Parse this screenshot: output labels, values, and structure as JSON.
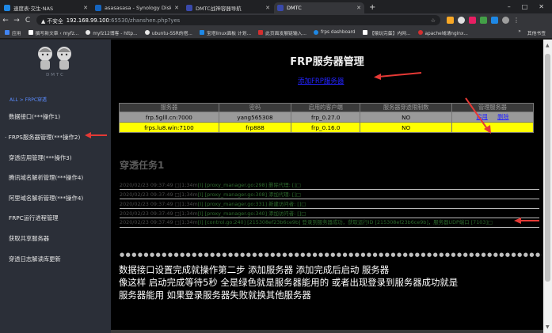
{
  "browser": {
    "tabs": [
      {
        "title": "速度表·交生·NAS",
        "color": "#1e88e5"
      },
      {
        "title": "asasasasa - Synology DiskStati",
        "color": "#1565c0"
      },
      {
        "title": "DMTC战神容器导航",
        "color": "#3949ab"
      },
      {
        "title": "DMTC",
        "color": "#3949ab"
      }
    ],
    "new_tab": "+",
    "win_min": "–",
    "win_max": "□",
    "win_close": "✕",
    "back": "←",
    "forward": "→",
    "reload": "C",
    "security_label": "▲ 不安全",
    "url_host": "192.168.99.100",
    "url_rest": ":65530/zhanshen.php?yes",
    "star": "☆",
    "bookmarks": [
      {
        "label": "应用",
        "color": "#4285f4"
      },
      {
        "label": "撰写新文章 ‹ myfz...",
        "color": "#ffffff"
      },
      {
        "label": "myfz12博客 - http...",
        "color": "#e8e8e8"
      },
      {
        "label": "ubuntu-SSR的搭...",
        "color": "#e8e8e8"
      },
      {
        "label": "宝塔linux面板 计划...",
        "color": "#1e88e5"
      },
      {
        "label": "此页面发展链输入...",
        "color": "#d32f2f"
      },
      {
        "label": "frps dashboard",
        "color": "#1e88e5"
      },
      {
        "label": "【猿玩完蛋】内网...",
        "color": "#ffffff"
      },
      {
        "label": "apache域请nginx...",
        "color": "#d32f2f"
      }
    ],
    "bookmarks_more": "»",
    "other_bookmarks": "其他书签"
  },
  "sidebar": {
    "brand": "DMTC",
    "breadcrumb": "ALL > FRPC穿透",
    "items": [
      {
        "label": "数据接口(***操作1)"
      },
      {
        "label": "· FRPS服务器管理(***操作2)"
      },
      {
        "label": "穿透应用管理(***操作3)"
      },
      {
        "label": "腾讯域名解析管理(***操作4)"
      },
      {
        "label": "阿里域名解析管理(***操作4)"
      },
      {
        "label": "FRPC运行进程管理"
      },
      {
        "label": "获取共享服务器"
      },
      {
        "label": "穿透日志解读库更新"
      }
    ]
  },
  "main": {
    "title": "FRP服务器管理",
    "add_link": "添加FRP服务器",
    "table": {
      "headers": [
        "服务器",
        "密码",
        "启用的客户端",
        "服务器穿透限制数",
        "管理服务器"
      ],
      "rows": [
        {
          "server": "frp.5glll.cn:7000",
          "password": "yang565308",
          "client": "frp_0.27.0",
          "limit": "NO",
          "enable": "启用",
          "delete": "删除"
        },
        {
          "server": "frps.lu8.win:7100",
          "password": "frp888",
          "client": "frp_0.16.0",
          "limit": "NO",
          "enable": "",
          "delete": ""
        }
      ]
    },
    "tasks_title": "穿透任务1",
    "logs": [
      {
        "prefix": "2020/02/23 09:37:49 □[1;34m",
        "msg": "[I] [proxy_manager.go:298] 删除代理: []□"
      },
      {
        "prefix": "2020/02/23 09:37:49 □[1;34m",
        "msg": "[I] [proxy_manager.go:308] 添加代理: []□"
      },
      {
        "prefix": "2020/02/23 09:37:49 □[1;34m",
        "msg": "[I] [proxy_manager.go:331] 新建访问者: []□"
      },
      {
        "prefix": "2020/02/23 09:37:49 □[1;34m",
        "msg": "[I] [proxy_manager.go:340] 添加访问者: []□"
      },
      {
        "prefix": "2020/02/23 09:37:49 □[1;34m",
        "msg": "[I] [control.go:240] [215308ef23b6ce9b] 登录到服务器成功，获取运行ID [215308ef23b6ce9b]，服务器UDP端口 [7103]□"
      }
    ],
    "note_lines": [
      "数据接口设置完成就操作第二步 添加服务器 添加完成后启动 服务器",
      "像这样 启动完成等待5秒 全是绿色就是服务器能用的 或者出现登录到服务器成功就是",
      "服务器能用 如果登录服务器失败就换其他服务器"
    ]
  },
  "colors": {
    "sidebar_bg": "#2b2f38",
    "highlight_row": "#ffff00",
    "link_blue": "#2323ff",
    "arrow_red": "#e53935"
  }
}
